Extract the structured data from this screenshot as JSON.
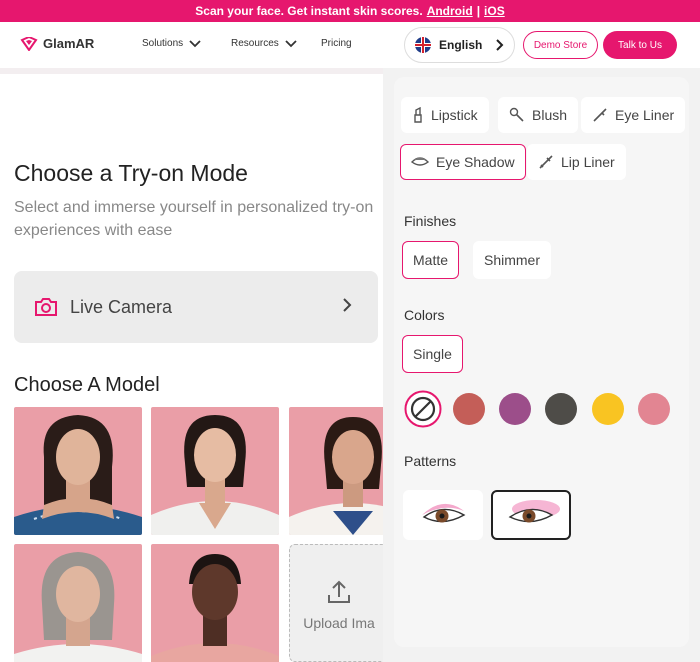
{
  "banner": {
    "text": "Scan your face. Get instant skin scores.",
    "android": "Android",
    "separator": "|",
    "ios": "iOS"
  },
  "nav": {
    "logo": "GlamAR",
    "solutions": "Solutions",
    "resources": "Resources",
    "pricing": "Pricing",
    "language": "English",
    "demo_store": "Demo Store",
    "talk": "Talk to Us"
  },
  "main": {
    "title": "Choose a Try-on Mode",
    "subtitle": "Select and immerse yourself in personalized try-on experiences with ease",
    "live_camera": "Live Camera",
    "models_title": "Choose A Model",
    "upload": "Upload Ima"
  },
  "panel": {
    "categories": [
      "Lipstick",
      "Blush",
      "Eye Liner",
      "Eye Shadow",
      "Lip Liner"
    ],
    "selected_category": "Eye Shadow",
    "finishes_label": "Finishes",
    "finishes": [
      "Matte",
      "Shimmer"
    ],
    "selected_finish": "Matte",
    "colors_label": "Colors",
    "color_mode": "Single",
    "swatches": [
      "#c45e58",
      "#9c4e8a",
      "#4e4c48",
      "#f9c422",
      "#e28592"
    ],
    "patterns_label": "Patterns",
    "accent": "#e6176e"
  }
}
